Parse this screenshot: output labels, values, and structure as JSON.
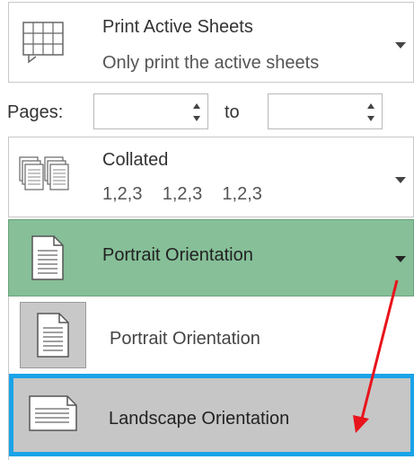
{
  "print_what": {
    "title": "Print Active Sheets",
    "subtitle": "Only print the active sheets",
    "icon": "sheet-grid-icon"
  },
  "pages": {
    "label": "Pages:",
    "from_value": "",
    "to_label": "to",
    "to_value": ""
  },
  "collation": {
    "title": "Collated",
    "subtitle": "1,2,3    1,2,3    1,2,3",
    "icon": "collated-pages-icon"
  },
  "orientation": {
    "selected": "Portrait Orientation",
    "icon": "portrait-page-icon",
    "accent": "#86bf98",
    "options": [
      {
        "label": "Portrait Orientation",
        "icon": "portrait-page-icon"
      },
      {
        "label": "Landscape Orientation",
        "icon": "landscape-page-icon",
        "highlight": "#1aa3e8"
      }
    ]
  },
  "annotation": {
    "arrow_color": "#e8141b"
  }
}
